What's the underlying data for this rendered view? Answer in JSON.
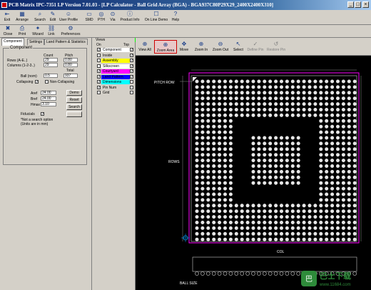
{
  "window": {
    "title": "PCB Matrix IPC-7351 LP Version 7.01.03 - [LP Calculator - Ball Grid Array (BGA) - BGA937C80P29X29_2400X2400X310]"
  },
  "toolbar_top": [
    {
      "label": "Exit",
      "icon": "exit-icon"
    },
    {
      "label": "Arrange",
      "icon": "arrange-icon"
    },
    {
      "label": "Search",
      "icon": "search-icon"
    },
    {
      "label": "Edit",
      "icon": "edit-icon"
    },
    {
      "label": "User Profile",
      "icon": "user-profile-icon"
    },
    {
      "label": "SMD",
      "icon": "smd-icon"
    },
    {
      "label": "PTH",
      "icon": "pth-icon"
    },
    {
      "label": "Via",
      "icon": "via-icon"
    },
    {
      "label": "Product Info",
      "icon": "info-icon"
    },
    {
      "label": "On Line Demo",
      "icon": "demo-icon"
    },
    {
      "label": "Help",
      "icon": "help-icon"
    }
  ],
  "toolbar_second": [
    {
      "label": "Close",
      "icon": "close-icon"
    },
    {
      "label": "Print",
      "icon": "print-icon"
    },
    {
      "label": "Wizard",
      "icon": "wizard-icon"
    },
    {
      "label": "Link",
      "icon": "link-icon"
    },
    {
      "label": "Preferences",
      "icon": "preferences-icon"
    }
  ],
  "left_tabs": [
    "Component",
    "Settings",
    "Land Pattern & Statistics"
  ],
  "component": {
    "group_title": "Component",
    "col_count": "Count",
    "col_pitch": "Pitch",
    "rows_label": "Rows (A-E..)",
    "rows_count": "29",
    "rows_pitch": "0.80",
    "cols_label": "Columns (1-2-3..)",
    "cols_count": "29",
    "cols_pitch": "0.80",
    "total_label": "Total",
    "ball_label": "Ball (nom)",
    "ball_value": "0.5",
    "total_value": "937",
    "collapsing_label": "Collapsing",
    "collapsing_check": "✓",
    "noncollapsing_label": "Non-Collapsing",
    "dim1_label": "Aref",
    "dim1_value": "24.00",
    "dim2_label": "Bref",
    "dim2_value": "24.00",
    "dim3_label": "Hmax",
    "dim3_value": "3.10",
    "btn_demo": "Demo",
    "btn_reset": "Reset",
    "btn_search": "Search",
    "fiducials_label": "Fiducials",
    "fiducials_check": "✓",
    "note_line1": "*Not a search option",
    "note_line2": "(Units are in mm)"
  },
  "views": {
    "title": "Views",
    "col_on": "On",
    "col_top": "Top",
    "layers": [
      {
        "name": "Component",
        "color": "#ffffff",
        "on": "✓",
        "top": "✓"
      },
      {
        "name": "Inside",
        "color": "#d4d0c8",
        "on": "",
        "top": "✓"
      },
      {
        "name": "Assembly",
        "color": "#ffff00",
        "on": "",
        "top": "✓"
      },
      {
        "name": "Silkscreen",
        "color": "#ffffff",
        "on": "",
        "top": "✓"
      },
      {
        "name": "Courtyard",
        "color": "#ff00ff",
        "on": "✓",
        "top": "✓"
      },
      {
        "name": "Land Pattern",
        "color": "#0000ff",
        "on": "✓",
        "top": "✓"
      },
      {
        "name": "Dimensions",
        "color": "#00ffff",
        "on": "✓",
        "top": ""
      },
      {
        "name": "Pin Num",
        "color": "#d4d0c8",
        "on": "✓",
        "top": ""
      },
      {
        "name": "Grid",
        "color": "#d4d0c8",
        "on": "",
        "top": ""
      }
    ]
  },
  "view_toolbar": [
    {
      "label": "View All",
      "icon": "view-all-icon"
    },
    {
      "label": "Zoom Area",
      "icon": "zoom-area-icon"
    },
    {
      "label": "Move",
      "icon": "move-icon"
    },
    {
      "label": "Zoom In",
      "icon": "zoom-in-icon"
    },
    {
      "label": "Zoom Out",
      "icon": "zoom-out-icon"
    },
    {
      "label": "Select",
      "icon": "select-icon"
    },
    {
      "label": "Define Pin",
      "icon": "define-pin-icon"
    },
    {
      "label": "Restore Pin",
      "icon": "restore-pin-icon"
    }
  ],
  "canvas": {
    "pitch_row_label": "PITCH ROW",
    "rows_label": "ROWS",
    "col_label": "COL",
    "ball_size_label": "BALL SIZE",
    "grid_rows": 29,
    "grid_cols": 29,
    "void_start": 7,
    "void_end": 21,
    "island_start": 10,
    "island_end": 18
  },
  "watermark": {
    "line1": "巴士下载",
    "line2": "www.11684.com"
  }
}
